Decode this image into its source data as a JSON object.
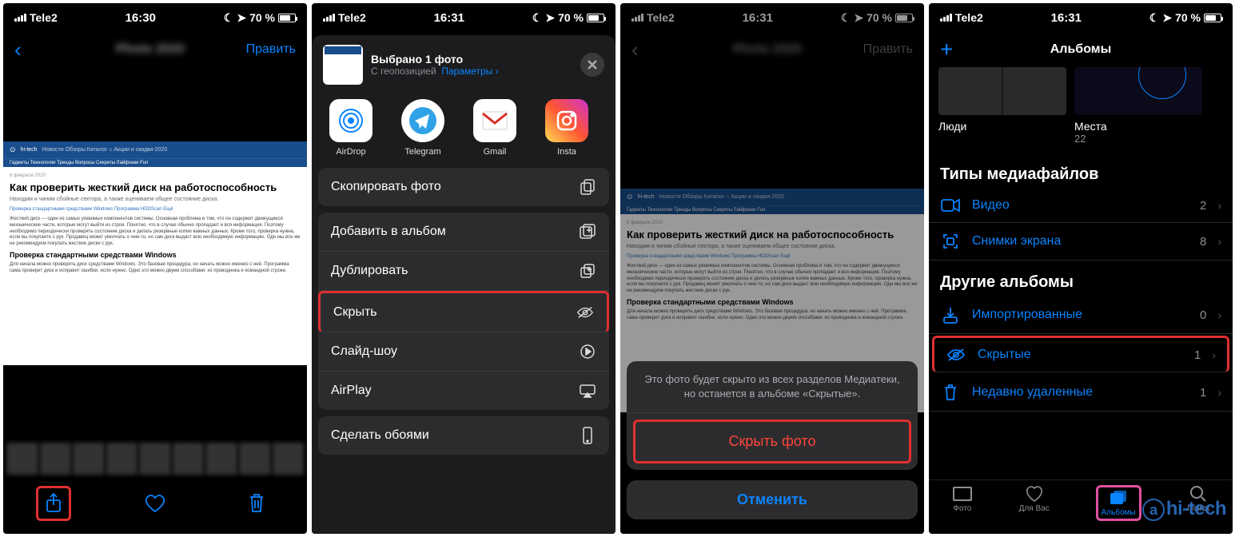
{
  "status": {
    "carrier": "Tele2",
    "time1": "16:30",
    "time2": "16:31",
    "battery": "70 %"
  },
  "screen1": {
    "edit": "Править",
    "article": {
      "site": "hi-tech",
      "topnav": "Новости   Обзоры   Каталог   ⌂ Акции и скидки-2020",
      "subnav": "Гаджеты   Технологии   Тренды   Вопросы   Секреты   Лайфхаки   Fun",
      "date": "6 февраля 2020",
      "h1": "Как проверить жесткий диск на работоспособность",
      "sub": "Находим и чиним сбойные сектора, а также оцениваем общее состояние диска.",
      "links": "Проверка стандартными средствами Windows    Программа HDDScan    Ещё",
      "p1": "Жесткий диск — один из самых уязвимых компонентов системы. Основная проблема в том, что он содержит движущиеся механические части, которые могут выйти из строя. Понятно, что в случае обычно пропадает и вся информация. Поэтому необходимо периодически проверять состояние диска и делать резервные копии важных данных. Кроме того, проверка нужна, если вы покупаете с рук. Продавец может умолчать о чем-то, но сам диск выдаст всю необходимую информацию. Одн мы все же не рекомендуем покупать жесткие диски с рук.",
      "h2": "Проверка стандартными средствами Windows",
      "p2": "Для начала можно проверить диск средствами Windows. Это базовая процедура, но начать можно именно с неё. Программа сама проверит диск и исправит ошибки, если нужно. Одно это можно двумя способами: из проводника и командной строки."
    }
  },
  "screen2": {
    "head_title": "Выбрано 1 фото",
    "head_sub": "С геопозицией",
    "head_opt": "Параметры",
    "apps": {
      "a1": "AirDrop",
      "a2": "Telegram",
      "a3": "Gmail",
      "a4": "Insta"
    },
    "actions": {
      "copy": "Скопировать фото",
      "add": "Добавить в альбом",
      "dup": "Дублировать",
      "hide": "Скрыть",
      "slide": "Слайд-шоу",
      "airplay": "AirPlay",
      "wallpaper": "Сделать обоями"
    }
  },
  "screen3": {
    "msg": "Это фото будет скрыто из всех разделов Медиатеки, но останется в альбоме «Скрытые».",
    "hide": "Скрыть фото",
    "cancel": "Отменить"
  },
  "screen4": {
    "title": "Альбомы",
    "tiles": {
      "people": "Люди",
      "places": "Места",
      "places_count": "22"
    },
    "sec1": "Типы медиафайлов",
    "rows1": {
      "video": "Видео",
      "video_count": "2",
      "shots": "Снимки экрана",
      "shots_count": "8"
    },
    "sec2": "Другие альбомы",
    "rows2": {
      "imported": "Импортированные",
      "imported_c": "0",
      "hidden": "Скрытые",
      "hidden_c": "1",
      "deleted": "Недавно удаленные",
      "deleted_c": "1"
    },
    "tabs": {
      "t1": "Фото",
      "t2": "Для Вас",
      "t3": "Альбомы",
      "t4": "Поиск"
    },
    "watermark": "hi-tech"
  }
}
